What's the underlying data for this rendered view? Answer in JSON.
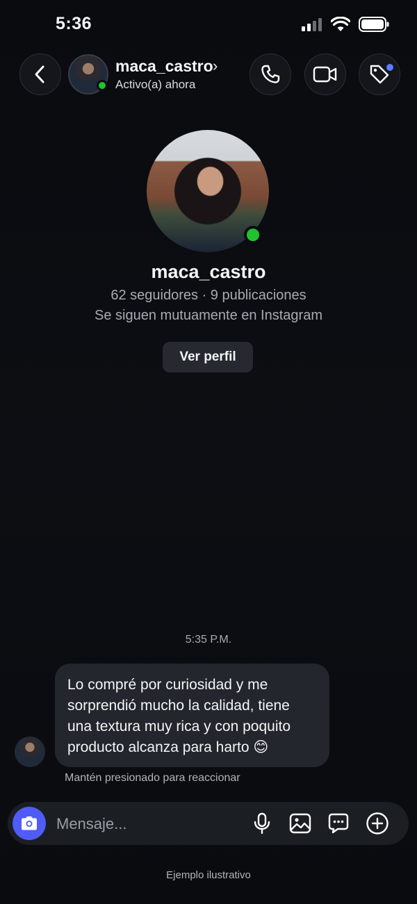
{
  "status_bar": {
    "time": "5:36"
  },
  "header": {
    "username": "maca_castro",
    "chevron": "›",
    "status": "Activo(a) ahora",
    "icons": [
      "back-arrow-icon",
      "phone-icon",
      "video-camera-icon",
      "tag-icon"
    ],
    "online_color": "#1fc32d",
    "notification_dot_color": "#5b7cff"
  },
  "profile": {
    "username": "maca_castro",
    "stats": "62 seguidores · 9 publicaciones",
    "mutual": "Se siguen mutuamente en Instagram",
    "view_profile_label": "Ver perfil"
  },
  "conversation": {
    "timestamp": "5:35 P.M.",
    "messages": [
      {
        "text": "Lo compré por curiosidad y me sorprendió mucho la calidad, tiene una textura muy rica y con poquito producto alcanza para harto 😊"
      }
    ],
    "hold_hint": "Mantén presionado para reaccionar"
  },
  "composer": {
    "placeholder": "Mensaje...",
    "accent_color": "#4f5cf7",
    "icons": [
      "camera-icon",
      "microphone-icon",
      "gallery-icon",
      "sticker-icon",
      "plus-icon"
    ]
  },
  "footer": {
    "note": "Ejemplo ilustrativo"
  }
}
